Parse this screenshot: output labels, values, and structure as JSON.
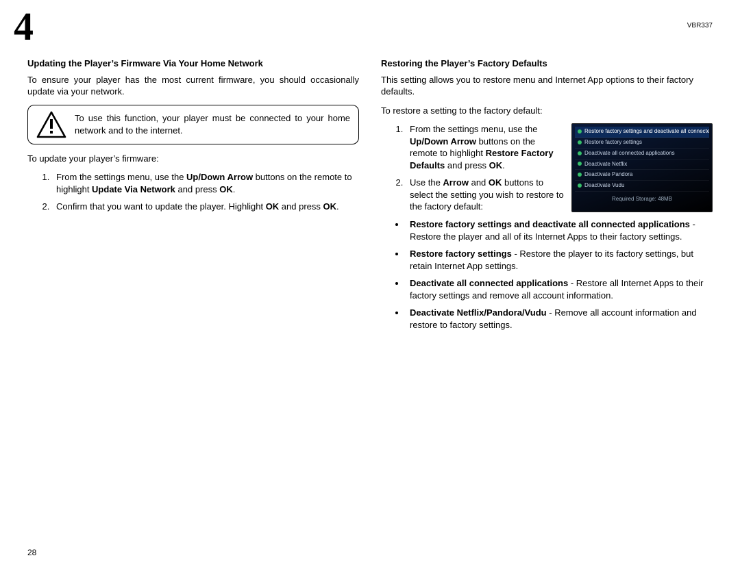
{
  "chapter_number": "4",
  "model": "VBR337",
  "page_number": "28",
  "left": {
    "heading": "Updating the Player’s Firmware Via Your Home Network",
    "intro": "To ensure your player has the most current firmware, you should occasionally update via your network.",
    "notice": "To use this function, your player must be connected to your home network and to the internet.",
    "lead": "To update your player’s firmware:",
    "step1_a": "From the settings menu, use the ",
    "step1_b": "Up/Down Arrow",
    "step1_c": " buttons on the remote to highlight ",
    "step1_d": "Update Via Network",
    "step1_e": " and press ",
    "step1_f": "OK",
    "step1_g": ".",
    "step2_a": "Confirm that you want to update the player. Highlight ",
    "step2_b": "OK",
    "step2_c": " and press ",
    "step2_d": "OK",
    "step2_e": "."
  },
  "right": {
    "heading": "Restoring the Player’s Factory Defaults",
    "intro": "This setting allows you to restore menu and Internet App options to their factory defaults.",
    "lead": "To restore a setting to the factory default:",
    "step1_a": "From the settings menu, use the ",
    "step1_b": "Up/Down Arrow",
    "step1_c": " buttons on the remote to highlight ",
    "step1_d": "Restore Factory Defaults",
    "step1_e": " and press ",
    "step1_f": "OK",
    "step1_g": ".",
    "step2_a": "Use the ",
    "step2_b": "Arrow",
    "step2_c": " and ",
    "step2_d": "OK",
    "step2_e": " buttons to select the setting you wish to restore to the factory default:",
    "b1_a": "Restore factory settings and deactivate all connected applications",
    "b1_b": " - Restore the player and all of its Internet Apps to their factory settings.",
    "b2_a": "Restore factory settings",
    "b2_b": " - Restore the player to its factory settings, but retain Internet App settings.",
    "b3_a": "Deactivate all connected applications",
    "b3_b": " - Restore all Internet Apps to their factory settings and remove all account information.",
    "b4_a": "Deactivate Netflix/Pandora/Vudu",
    "b4_b": " - Remove all account information and restore to factory settings."
  },
  "shot": {
    "r1": "Restore factory settings and deactivate all connected applications",
    "r2": "Restore factory settings",
    "r3": "Deactivate all connected applications",
    "r4": "Deactivate Netflix",
    "r5": "Deactivate Pandora",
    "r6": "Deactivate Vudu",
    "footer": "Required Storage: 48MB"
  }
}
